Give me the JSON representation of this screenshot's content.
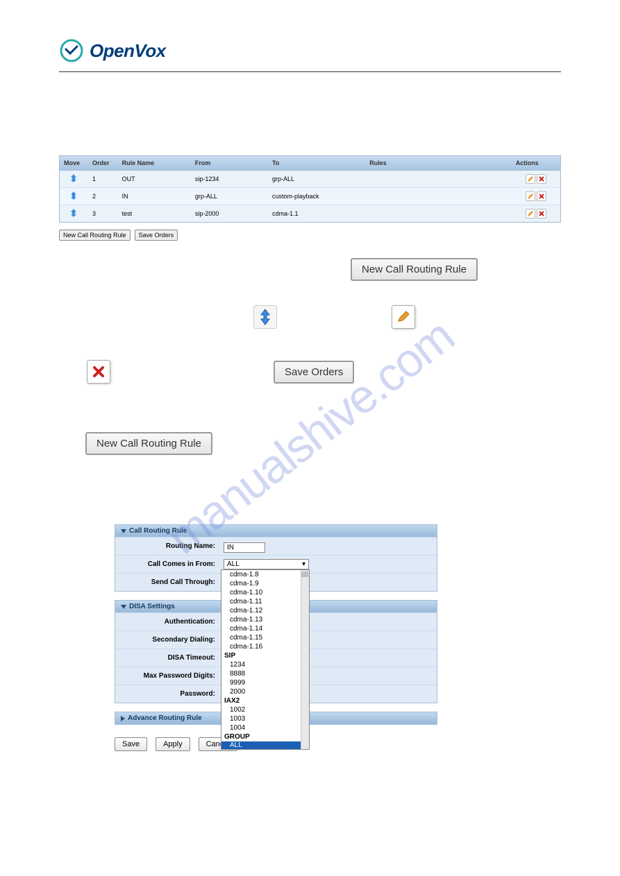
{
  "logo": {
    "text": "OpenVox"
  },
  "watermark": "manualshive.com",
  "table": {
    "headers": {
      "move": "Move",
      "order": "Order",
      "rule_name": "Rule Name",
      "from": "From",
      "to": "To",
      "rules": "Rules",
      "actions": "Actions"
    },
    "rows": [
      {
        "order": "1",
        "name": "OUT",
        "from": "sip-1234",
        "to": "grp-ALL",
        "rules": ""
      },
      {
        "order": "2",
        "name": "IN",
        "from": "grp-ALL",
        "to": "custom-playback",
        "rules": ""
      },
      {
        "order": "3",
        "name": "test",
        "from": "sip-2000",
        "to": "cdma-1.1",
        "rules": ""
      }
    ]
  },
  "buttons": {
    "new_rule_small": "New Call Routing Rule",
    "save_orders_small": "Save Orders",
    "new_rule_big": "New Call Routing Rule",
    "save_orders_big": "Save Orders",
    "new_rule_big2": "New Call Routing Rule",
    "save": "Save",
    "apply": "Apply",
    "cancel": "Cancel"
  },
  "panels": {
    "routing": {
      "title": "Call Routing Rule",
      "routing_name_label": "Routing Name:",
      "routing_name_value": "IN",
      "comes_from_label": "Call Comes in From:",
      "comes_from_value": "ALL",
      "send_through_label": "Send Call Through:"
    },
    "disa": {
      "title": "DISA Settings",
      "auth_label": "Authentication:",
      "secondary_label": "Secondary Dialing:",
      "timeout_label": "DISA Timeout:",
      "max_pw_label": "Max Password Digits:",
      "password_label": "Password:"
    },
    "advance": {
      "title": "Advance Routing Rule"
    }
  },
  "dropdown": {
    "items": [
      "cdma-1.8",
      "cdma-1.9",
      "cdma-1.10",
      "cdma-1.11",
      "cdma-1.12",
      "cdma-1.13",
      "cdma-1.14",
      "cdma-1.15",
      "cdma-1.16"
    ],
    "sip_label": "SIP",
    "sip_items": [
      "1234",
      "8888",
      "9999",
      "2000"
    ],
    "iax_label": "IAX2",
    "iax_items": [
      "1002",
      "1003",
      "1004"
    ],
    "group_label": "GROUP",
    "selected": "ALL"
  }
}
